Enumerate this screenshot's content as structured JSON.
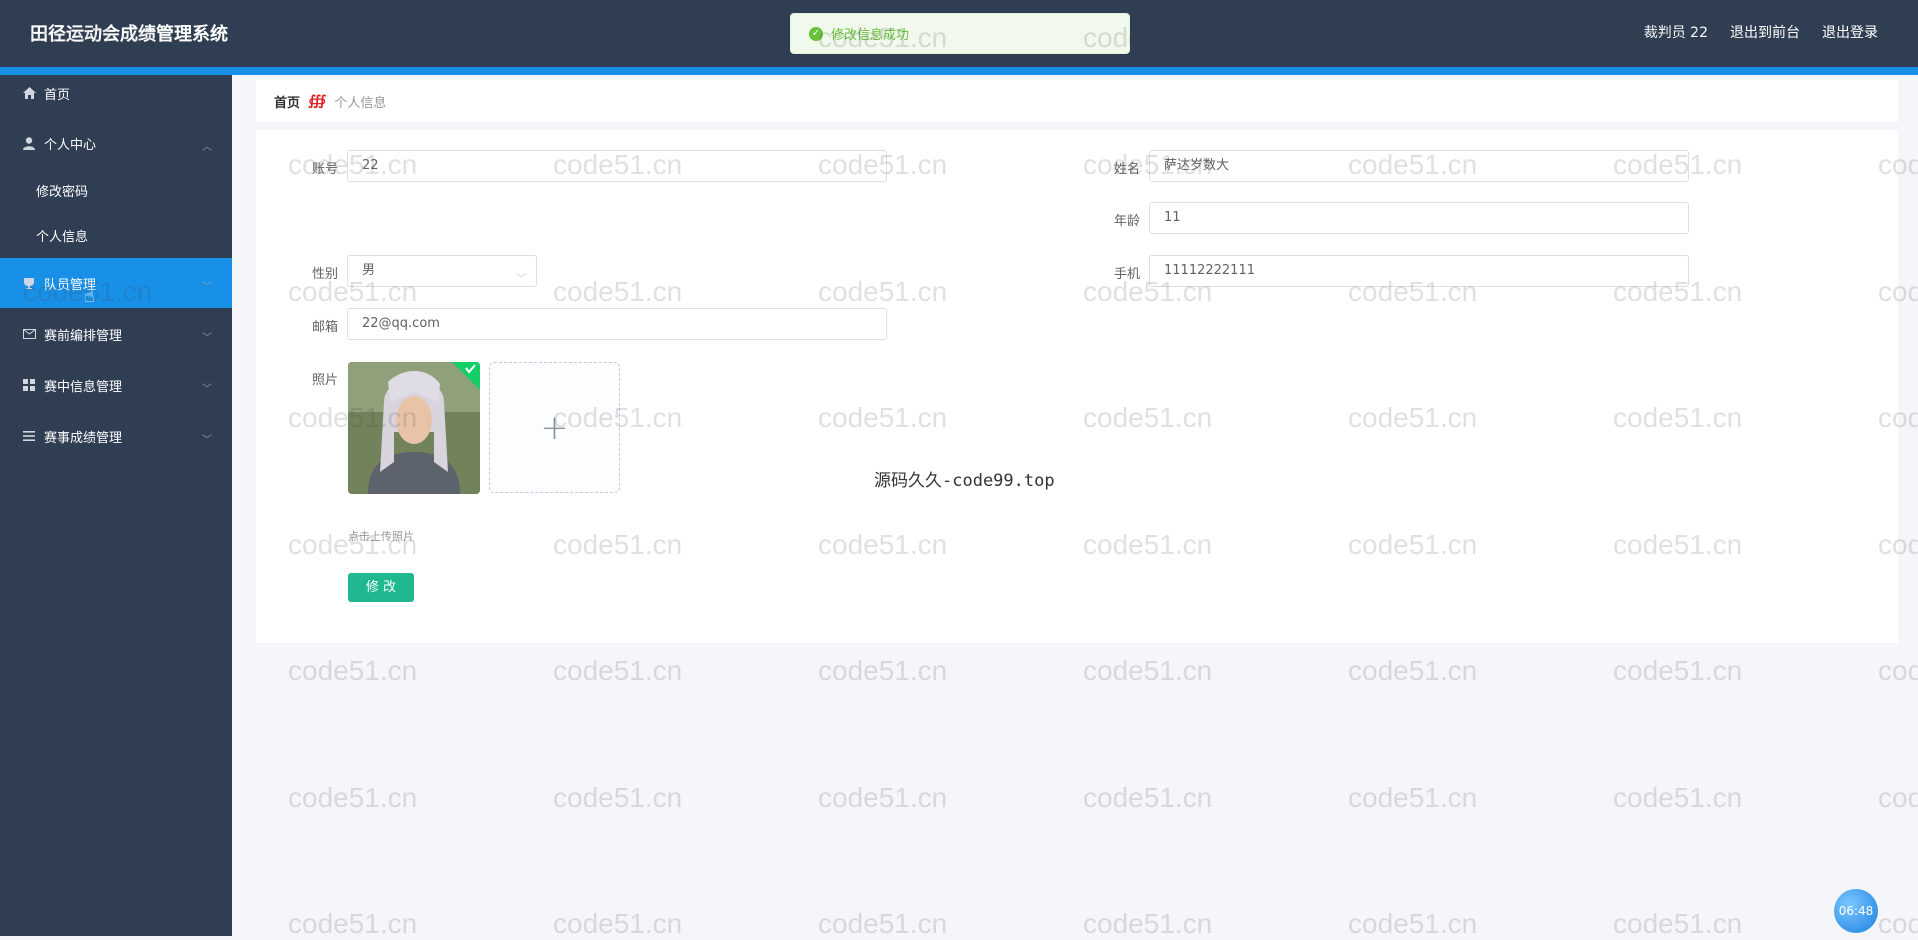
{
  "app": {
    "title": "田径运动会成绩管理系统"
  },
  "header": {
    "user": "裁判员 22",
    "to_front": "退出到前台",
    "logout": "退出登录"
  },
  "toast": {
    "text": "修改信息成功"
  },
  "sidebar": {
    "items": [
      {
        "label": "首页",
        "icon": "home-icon"
      },
      {
        "label": "个人中心",
        "icon": "user-icon",
        "expanded": true
      },
      {
        "label": "修改密码",
        "sub": true
      },
      {
        "label": "个人信息",
        "sub": true
      },
      {
        "label": "队员管理",
        "icon": "trophy-icon",
        "active": true
      },
      {
        "label": "赛前编排管理",
        "icon": "mail-icon"
      },
      {
        "label": "赛中信息管理",
        "icon": "grid-icon"
      },
      {
        "label": "赛事成绩管理",
        "icon": "list-icon"
      }
    ]
  },
  "breadcrumb": {
    "home": "首页",
    "separator": "∰",
    "current": "个人信息"
  },
  "form": {
    "account_label": "账号",
    "account_value": "22",
    "name_label": "姓名",
    "name_value": "萨达岁数大",
    "age_label": "年龄",
    "age_value": "11",
    "gender_label": "性别",
    "gender_value": "男",
    "phone_label": "手机",
    "phone_value": "11112222111",
    "email_label": "邮箱",
    "email_value": "22@qq.com",
    "photo_label": "照片",
    "upload_plus": "+",
    "upload_hint": "点击上传照片",
    "submit_label": "修 改"
  },
  "overlay": {
    "code_watermark": "源码久久-code99.top",
    "watermark_text": "code51.cn"
  },
  "clock": {
    "time": "06:48"
  },
  "colors": {
    "header": "#2f3e53",
    "accent": "#1890e8",
    "button": "#1fb890",
    "success": "#67c23a"
  }
}
